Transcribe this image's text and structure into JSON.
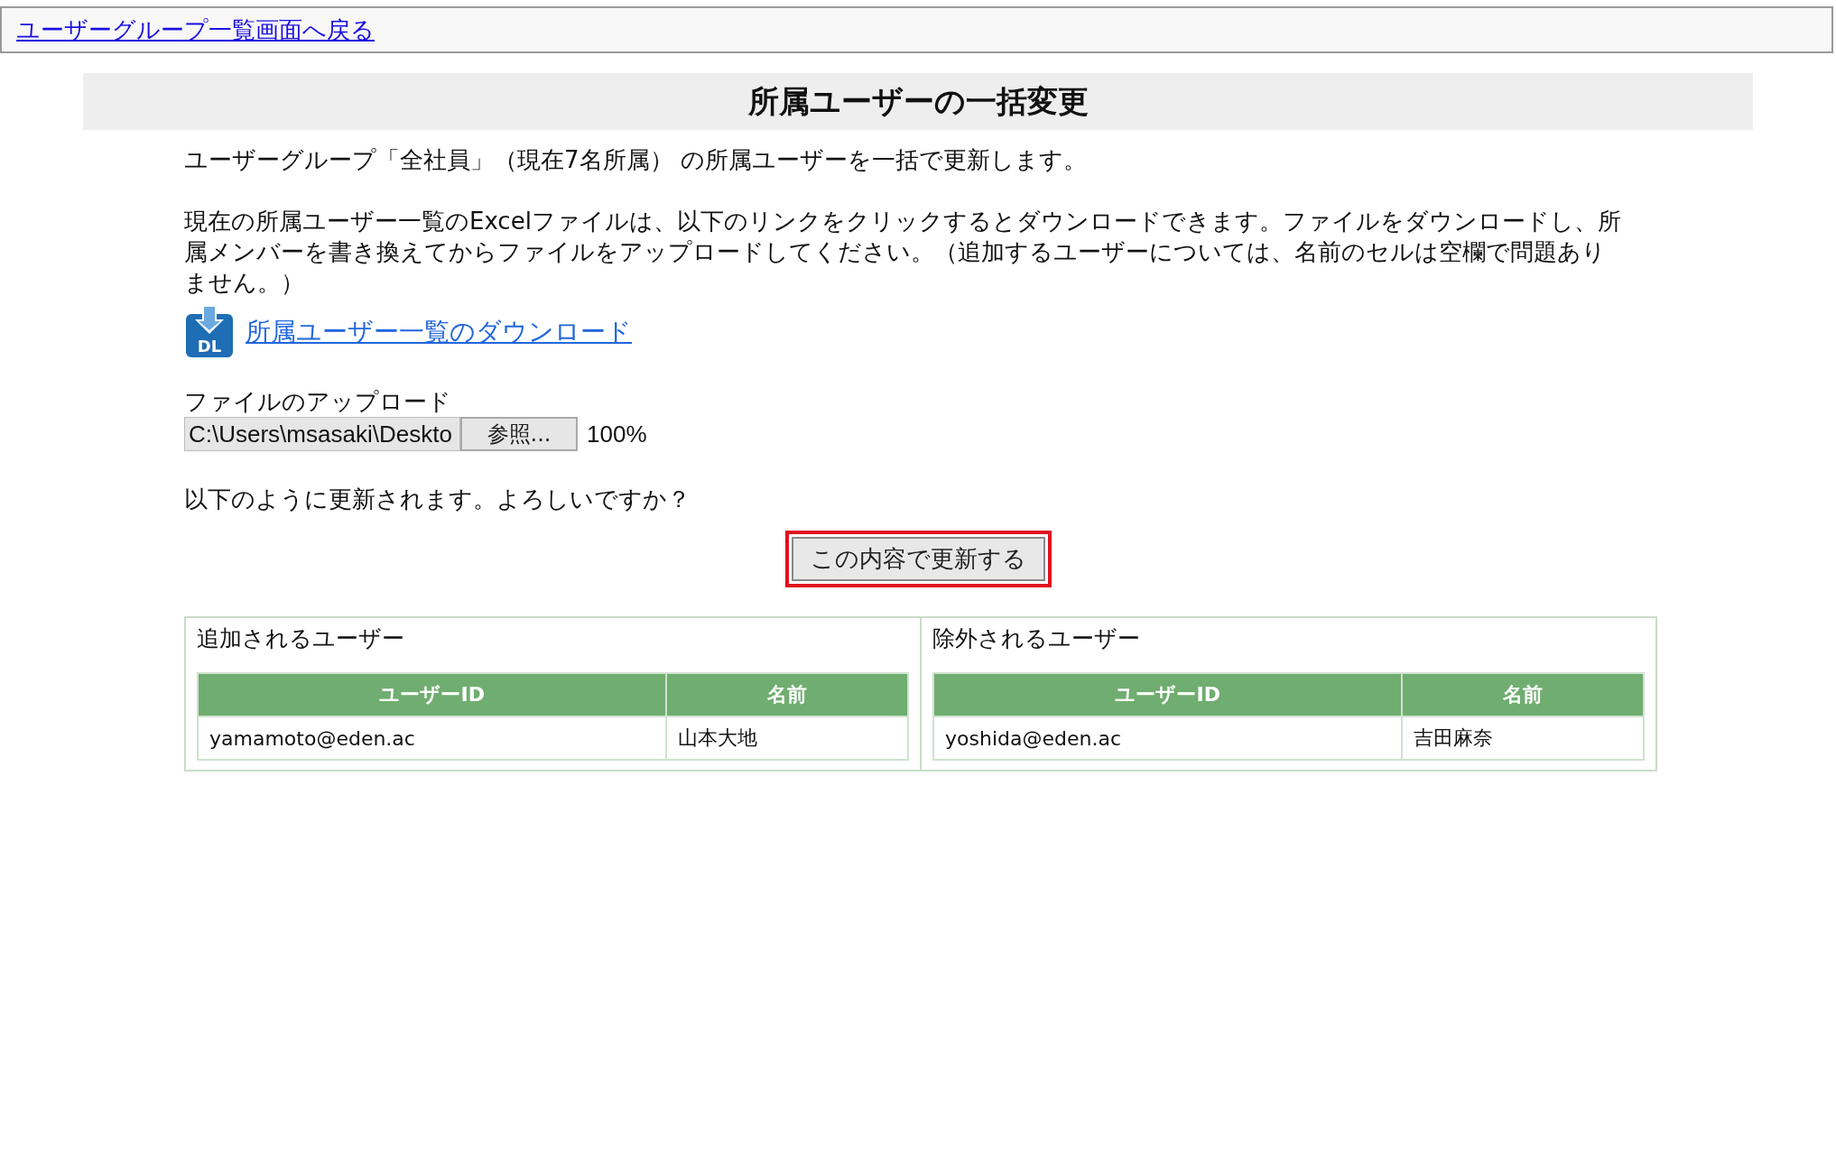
{
  "back_link": "ユーザーグループ一覧画面へ戻る",
  "title": "所属ユーザーの一括変更",
  "intro": "ユーザーグループ「全社員」（現在7名所属） の所属ユーザーを一括で更新します。",
  "instructions": "現在の所属ユーザー一覧のExcelファイルは、以下のリンクをクリックするとダウンロードできます。ファイルをダウンロードし、所属メンバーを書き換えてからファイルをアップロードしてください。（追加するユーザーについては、名前のセルは空欄で問題ありません。）",
  "download": {
    "icon_text": "DL",
    "link": "所属ユーザー一覧のダウンロード"
  },
  "upload": {
    "label": "ファイルのアップロード",
    "value": "C:\\Users\\msasaki\\Deskto",
    "browse_button": "参照...",
    "progress": "100%"
  },
  "confirm": "以下のように更新されます。よろしいですか？",
  "submit": {
    "label": "この内容で更新する",
    "focused": true
  },
  "panels": [
    {
      "heading": "追加されるユーザー",
      "columns": [
        "ユーザーID",
        "名前"
      ],
      "rows": [
        [
          "yamamoto@eden.ac",
          "山本大地"
        ]
      ]
    },
    {
      "heading": "除外されるユーザー",
      "columns": [
        "ユーザーID",
        "名前"
      ],
      "rows": [
        [
          "yoshida@eden.ac",
          "吉田麻奈"
        ]
      ]
    }
  ]
}
